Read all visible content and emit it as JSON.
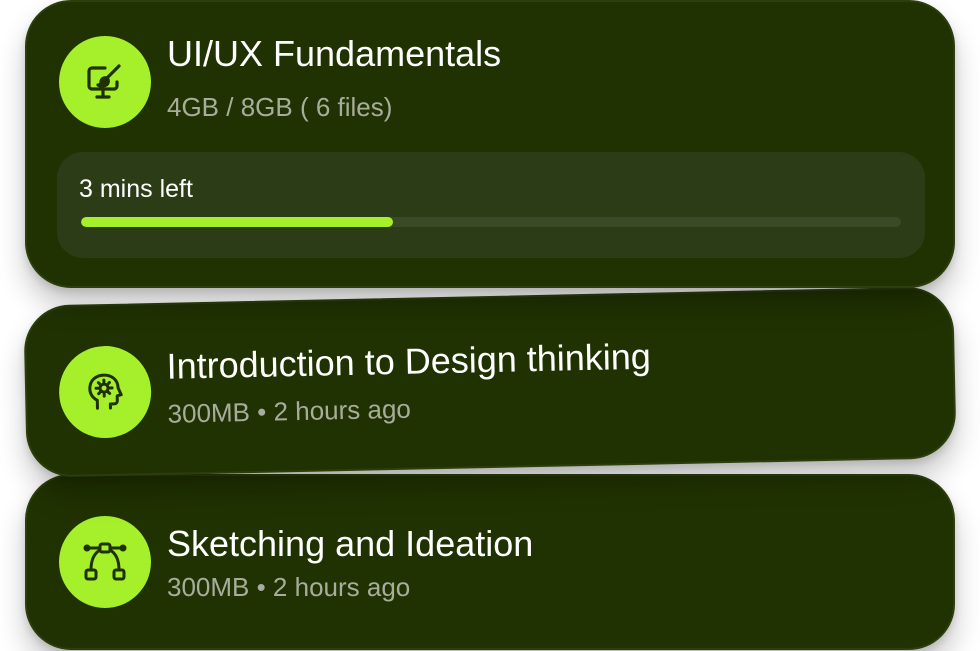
{
  "courses": [
    {
      "title": "UI/UX Fundamentals",
      "meta": "4GB / 8GB ( 6 files)",
      "icon": "design-monitor-brush-icon",
      "progress_label": "3 mins left",
      "progress_fraction": 0.38
    },
    {
      "title": "Introduction to Design thinking",
      "meta": "300MB • 2 hours ago",
      "icon": "head-gear-icon"
    },
    {
      "title": "Sketching and Ideation",
      "meta": "300MB • 2 hours ago",
      "icon": "bezier-pen-icon"
    }
  ],
  "colors": {
    "card_bg": "#203202",
    "accent": "#a6ef2b",
    "icon_stroke": "#1f3100",
    "title": "#ffffff",
    "meta": "#a7ad9c",
    "panel_bg": "#2c3c17",
    "track": "#3b4a26"
  }
}
